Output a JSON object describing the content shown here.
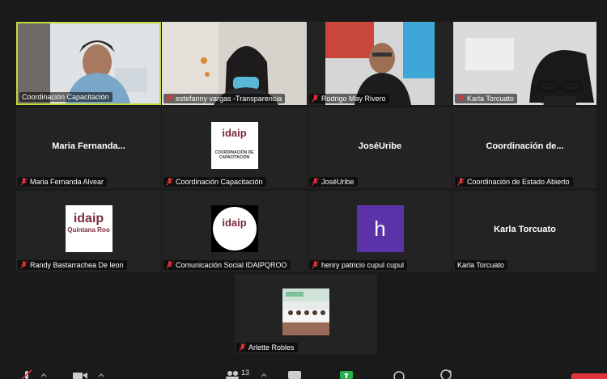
{
  "participants": [
    {
      "name": "Coordinación Capacitación",
      "muted": false,
      "active": true
    },
    {
      "name": "estefanny vargas -Transparencia",
      "muted": true
    },
    {
      "name": "Rodrigo May Rivero",
      "muted": true
    },
    {
      "name": "Karla Torcuato",
      "muted": true
    },
    {
      "name": "Maria Fernanda Alvear",
      "display": "Maria  Fernanda...",
      "muted": true
    },
    {
      "name": "Coordinación Capacitación",
      "muted": true,
      "logo_text": "COORDINACIÓN DE CAPACITACIÓN",
      "logo_brand": "idaip"
    },
    {
      "name": "JoséUribe",
      "display": "JoséUribe",
      "muted": true
    },
    {
      "name": "Coordinación de Estado Abierto",
      "display": "Coordinación  de...",
      "muted": true
    },
    {
      "name": "Randy Bastarrachea De leon",
      "muted": true,
      "logo_brand": "idaip",
      "logo_sub": "Quintana Roo"
    },
    {
      "name": "Comunicación Social IDAIPQROO",
      "muted": true,
      "logo_brand": "idaip"
    },
    {
      "name": "henry patricio cupul cupul",
      "muted": true,
      "initial": "h"
    },
    {
      "name": "Karla Torcuato",
      "display": "Karla Torcuato",
      "muted": false
    },
    {
      "name": "Arlette Robles",
      "muted": true
    }
  ],
  "toolbar": {
    "participants_count": "13"
  },
  "colors": {
    "active_border": "#c6d63c",
    "mute_red": "#e0343c",
    "initial_purple": "#5b33a8",
    "share_green": "#22b14c"
  }
}
